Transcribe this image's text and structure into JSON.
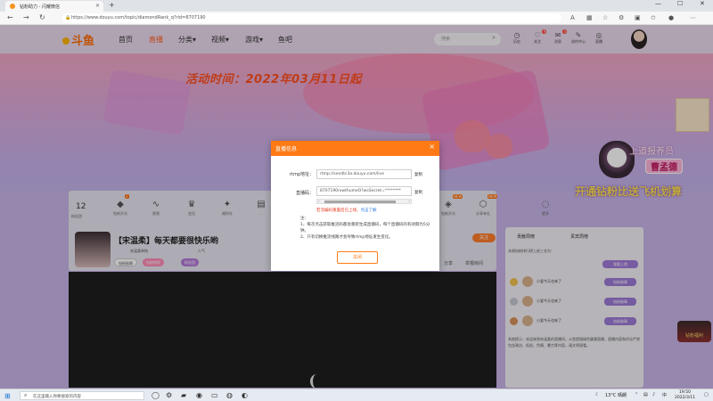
{
  "browser": {
    "tab_title": "钻粉助力 - 闪耀微信",
    "tab_close": "×",
    "new_tab": "+",
    "url": "https://www.douyu.com/topic/diamondRank_q?rid=8707190",
    "window_controls": [
      "—",
      "☐",
      "✕"
    ]
  },
  "header": {
    "logo": "斗鱼",
    "nav": [
      "首页",
      "直播",
      "分类",
      "视频",
      "游戏",
      "鱼吧"
    ],
    "search_placeholder": "搜索",
    "icons": [
      {
        "label": "历史",
        "glyph": "◷",
        "badge": ""
      },
      {
        "label": "关注",
        "glyph": "♡",
        "badge": "9"
      },
      {
        "label": "消息",
        "glyph": "✉",
        "badge": "4"
      },
      {
        "label": "创作中心",
        "glyph": "✎",
        "badge": ""
      },
      {
        "label": "直播",
        "glyph": "◎",
        "badge": ""
      }
    ]
  },
  "banner": {
    "event_date": "活动时间：2022年03月11日起",
    "promo_title": "上道报养员",
    "promo_name": "曹孟德",
    "promo_slogan": "开通钻粉比送飞机划算"
  },
  "room": {
    "stat_number": "12",
    "stat_sub": "粉丝团",
    "tools": [
      {
        "label": "钻粉开光",
        "glyph": "◆",
        "badge": "2"
      },
      {
        "label": "视频",
        "glyph": "∿",
        "badge": ""
      },
      {
        "label": "会员",
        "glyph": "♛",
        "badge": ""
      },
      {
        "label": "福利社",
        "glyph": "✦",
        "badge": ""
      },
      {
        "label": "…",
        "glyph": "▤",
        "badge": ""
      }
    ],
    "tools_right": [
      {
        "label": "钻粉开光",
        "glyph": "◈",
        "badge": "NEW"
      },
      {
        "label": "分享有礼",
        "glyph": "⬡",
        "badge": "NEW"
      },
      {
        "label": "更多",
        "glyph": "◌",
        "badge": ""
      }
    ],
    "title": "【宋温柔】每天都要很快乐哟",
    "meta": "宋温柔单纯",
    "meta2": "人气",
    "pills": [
      "钻粉勋章",
      "钻粉特权",
      "粉丝团"
    ],
    "follow": "关注",
    "share": "分享",
    "report": "举报房间"
  },
  "right_panel": {
    "tabs": [
      "贡献周榜",
      "贵宾周榜"
    ],
    "header": "本周钻粉排行榜上前三名为：",
    "button": "我要上榜",
    "rows": [
      {
        "text": "小爱今天也来了",
        "tag": "钻粉勋章"
      },
      {
        "text": "小爱今天也来了",
        "tag": "钻粉勋章"
      },
      {
        "text": "小爱今天也来了",
        "tag": "钻粉勋章"
      }
    ],
    "notice": "系统提示：欢迎来到宋温柔的直播间，斗鱼提倡绿色健康直播，直播内容和评论严禁包含政治、低俗、色情、暴力等内容，请文明观看。",
    "side_badge": "钻粉福利"
  },
  "modal": {
    "title": "直播信息",
    "close": "×",
    "rtmp_label": "rtmp地址：",
    "rtmp_value": "rtmp://sendtc3a.douyu.com/live",
    "code_label": "直播码：",
    "code_value": "8707190rxwthumeO?wsSecret=********",
    "copy": "复制",
    "scroll_left": "‹",
    "scroll_right": "›",
    "warn_text": "若流编码重置后已上线，",
    "warn_link": "点击了解",
    "notes": [
      "注：",
      "1、每次点击获取推流码都会重新生成直播码，每个直播码的有效期为5分钟。",
      "2、只有切换推流线路才会导致rtmp地址发生变化。"
    ],
    "confirm": "关闭"
  },
  "taskbar": {
    "search_placeholder": "在这里输入你要搜索的内容",
    "weather": "13°C 晴朗",
    "tray": "中",
    "time": "19:50",
    "date": "2022/3/11"
  }
}
